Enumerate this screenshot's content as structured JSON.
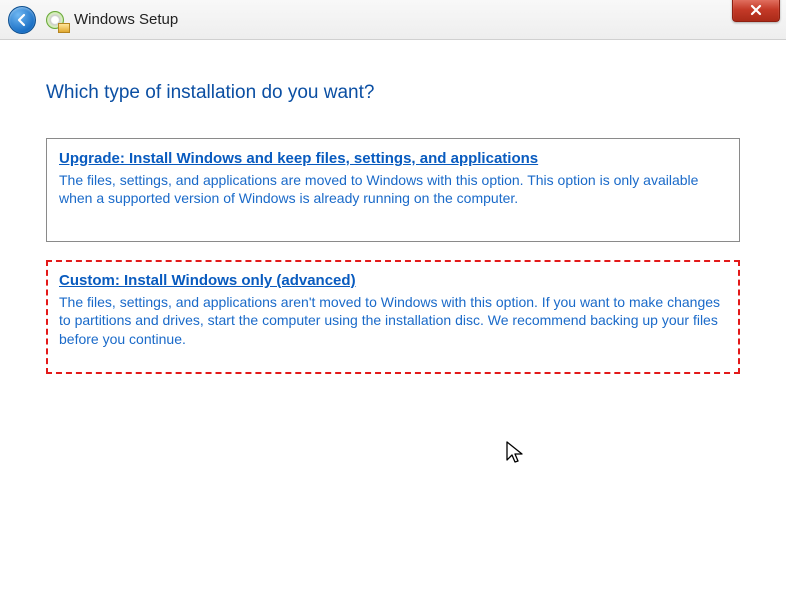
{
  "titlebar": {
    "title": "Windows Setup"
  },
  "heading": "Which type of installation do you want?",
  "options": {
    "upgrade": {
      "title": "Upgrade: Install Windows and keep files, settings, and applications",
      "description": "The files, settings, and applications are moved to Windows with this option. This option is only available when a supported version of Windows is already running on the computer."
    },
    "custom": {
      "title": "Custom: Install Windows only (advanced)",
      "description": "The files, settings, and applications aren't moved to Windows with this option. If you want to make changes to partitions and drives, start the computer using the installation disc. We recommend backing up your files before you continue."
    }
  }
}
